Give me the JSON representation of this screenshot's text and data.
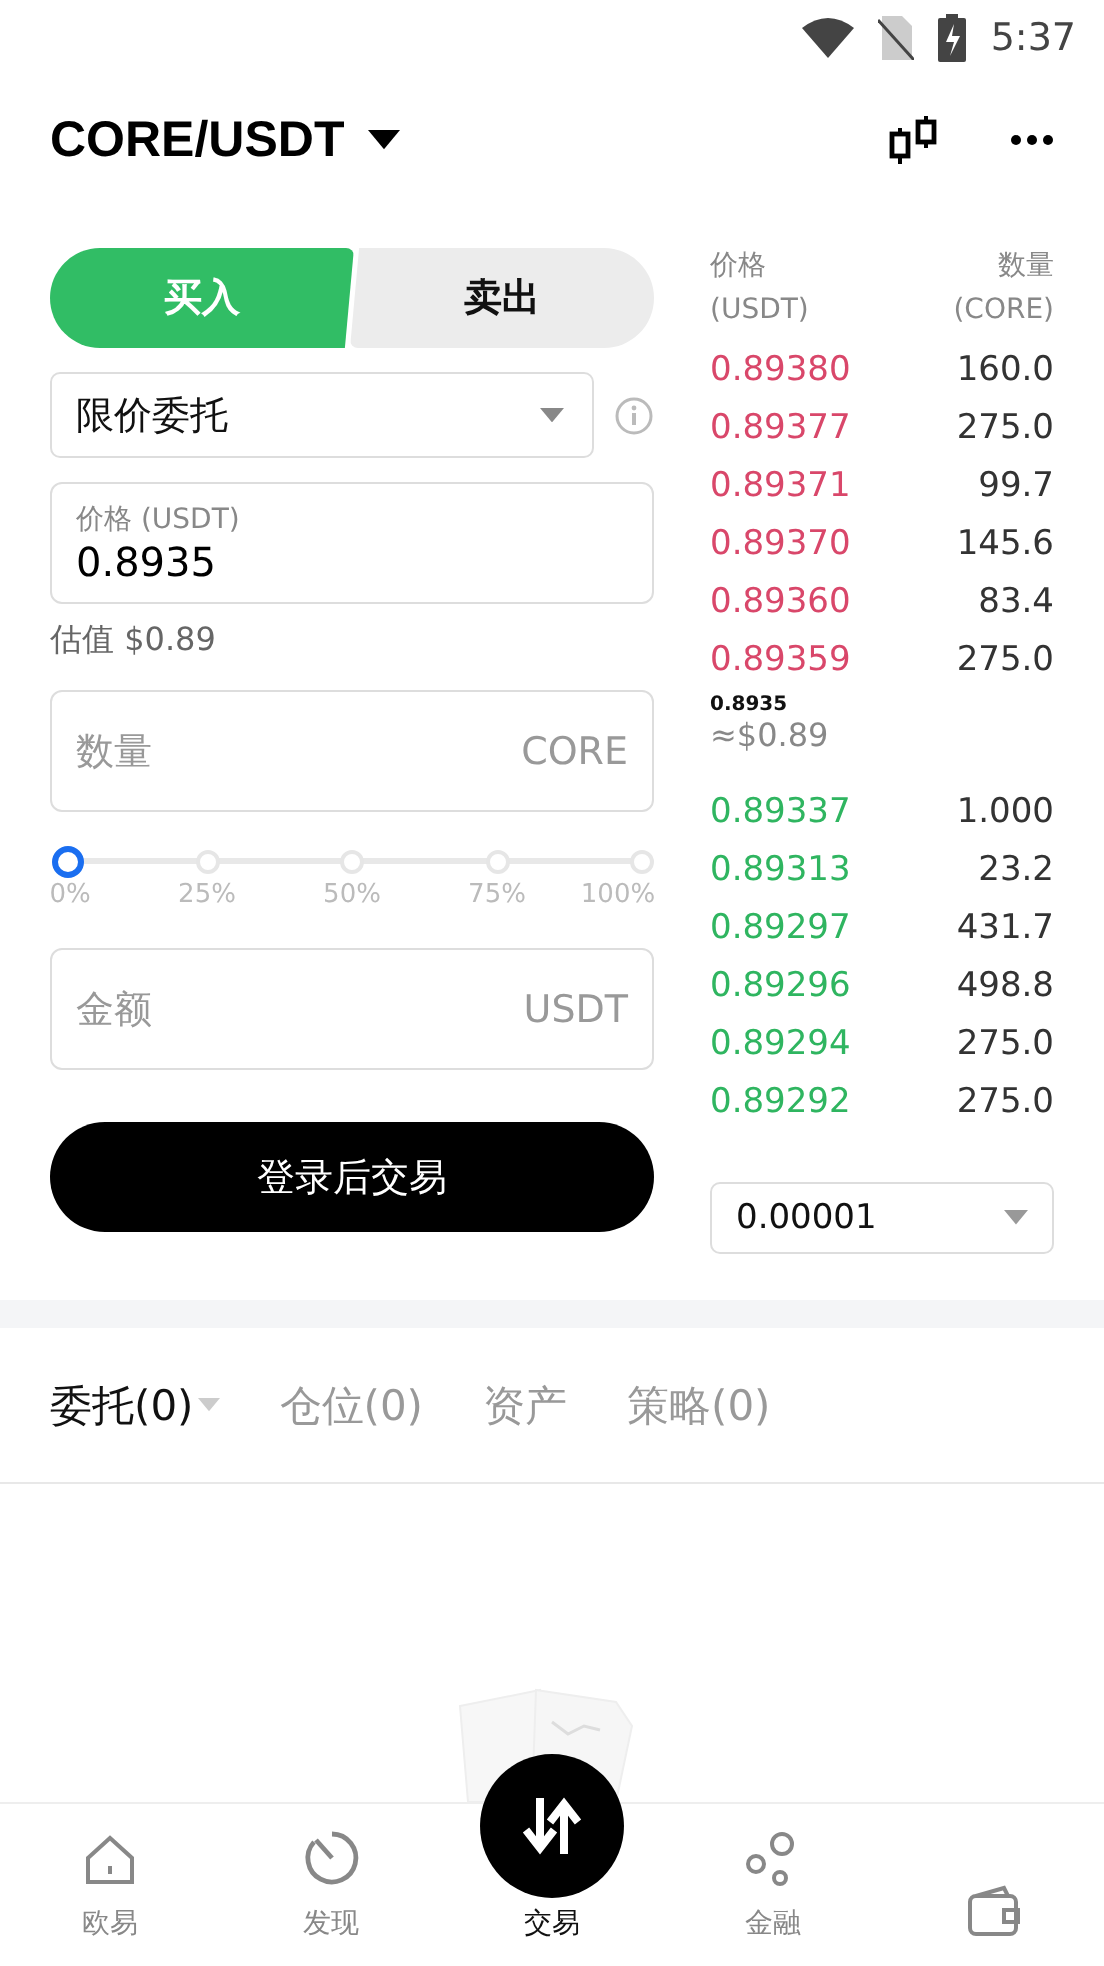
{
  "status_bar": {
    "time": "5:37"
  },
  "header": {
    "pair": "CORE/USDT"
  },
  "side_tabs": [
    {
      "label": "买入",
      "selected": true
    },
    {
      "label": "卖出",
      "selected": false
    }
  ],
  "order_type": {
    "value": "限价委托"
  },
  "price_field": {
    "label": "价格 (USDT)",
    "value": "0.8935"
  },
  "estimate": "估值 $0.89",
  "amount_field": {
    "placeholder": "数量",
    "unit": "CORE"
  },
  "slider": {
    "level": 0,
    "marks": [
      "0%",
      "25%",
      "50%",
      "75%",
      "100%"
    ]
  },
  "total_field": {
    "placeholder": "金额",
    "unit": "USDT"
  },
  "submit_button": "登录后交易",
  "order_book": {
    "price_header": "价格",
    "price_unit": "(USDT)",
    "qty_header": "数量",
    "qty_unit": "(CORE)",
    "asks": [
      {
        "price": "0.89380",
        "qty": "160.0"
      },
      {
        "price": "0.89377",
        "qty": "275.0"
      },
      {
        "price": "0.89371",
        "qty": "99.7"
      },
      {
        "price": "0.89370",
        "qty": "145.6"
      },
      {
        "price": "0.89360",
        "qty": "83.4"
      },
      {
        "price": "0.89359",
        "qty": "275.0"
      }
    ],
    "last_price": "0.8935",
    "last_price_usd": "≈$0.89",
    "bids": [
      {
        "price": "0.89337",
        "qty": "1.000"
      },
      {
        "price": "0.89313",
        "qty": "23.2"
      },
      {
        "price": "0.89297",
        "qty": "431.7"
      },
      {
        "price": "0.89296",
        "qty": "498.8"
      },
      {
        "price": "0.89294",
        "qty": "275.0"
      },
      {
        "price": "0.89292",
        "qty": "275.0"
      }
    ],
    "precision": "0.00001"
  },
  "order_tabs": [
    {
      "label": "委托(0)",
      "selected": true
    },
    {
      "label": "仓位(0)",
      "selected": false
    },
    {
      "label": "资产",
      "selected": false
    },
    {
      "label": "策略(0)",
      "selected": false
    }
  ],
  "bottom_nav": [
    {
      "kind": "home",
      "label": "欧易",
      "selected": false
    },
    {
      "kind": "discover",
      "label": "发现",
      "selected": false
    },
    {
      "kind": "trade",
      "label": "交易",
      "selected": true
    },
    {
      "kind": "finance",
      "label": "金融",
      "selected": false
    },
    {
      "kind": "wallet",
      "selected": false
    }
  ]
}
